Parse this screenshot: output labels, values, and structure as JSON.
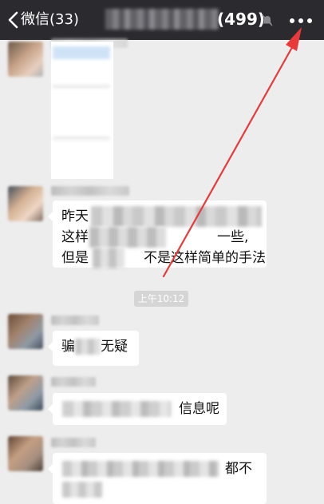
{
  "navbar": {
    "back_label": "微信(33)",
    "title_count": "(499)",
    "mute_icon": "bell-off-icon",
    "more_icon": "more-dots-icon"
  },
  "timestamp": "上午10:12",
  "messages": [
    {
      "type": "image"
    },
    {
      "type": "text",
      "lines": [
        "昨天",
        "这样",
        "但是",
        "不是这样简单的手法"
      ],
      "visible_tail_line2": "一些,"
    },
    {
      "type": "text",
      "prefix": "骗",
      "suffix": "无疑"
    },
    {
      "type": "text",
      "suffix": "信息呢"
    },
    {
      "type": "text",
      "suffix": "都不"
    }
  ],
  "colors": {
    "navbar": "#2b2b2f",
    "background": "#ededed",
    "bubble": "#ffffff",
    "arrow": "#e83a3a"
  }
}
